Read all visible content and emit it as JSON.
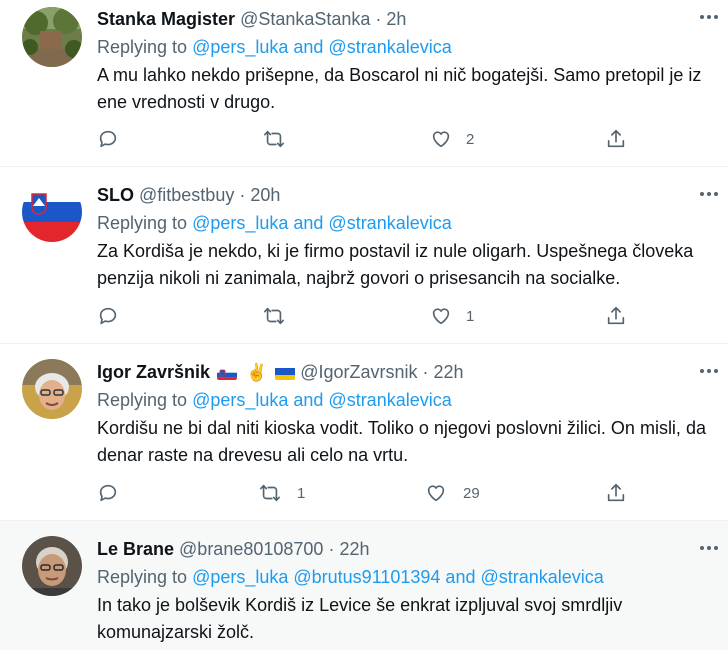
{
  "tweets": [
    {
      "name": "Stanka Magister",
      "handle": "@StankaStanka",
      "sep": "·",
      "time": "2h",
      "replying_prefix": "Replying to ",
      "mentions": "@pers_luka and @strankalevica",
      "text": "A mu lahko nekdo prišepne, da Boscarol ni nič bogatejši. Samo pretopil je iz ene vrednosti v drugo.",
      "retweets": "",
      "likes": "2"
    },
    {
      "name": "SLO",
      "handle": "@fitbestbuy",
      "sep": "·",
      "time": "20h",
      "replying_prefix": "Replying to ",
      "mentions": "@pers_luka and @strankalevica",
      "text": "Za Kordiša je nekdo, ki je firmo postavil iz nule oligarh. Uspešnega človeka penzija nikoli ni zanimala, najbrž govori o prisesancih na socialke.",
      "retweets": "",
      "likes": "1"
    },
    {
      "name": "Igor Završnik",
      "peace": "✌",
      "handle": "@IgorZavrsnik",
      "sep": "·",
      "time": "22h",
      "replying_prefix": "Replying to ",
      "mentions": "@pers_luka and @strankalevica",
      "text": "Kordišu ne bi dal niti kioska vodit. Toliko o njegovi poslovni žilici. On misli, da denar raste na drevesu ali celo na vrtu.",
      "retweets": "1",
      "likes": "29"
    },
    {
      "name": "Le Brane",
      "handle": "@brane80108700",
      "sep": "·",
      "time": "22h",
      "replying_prefix": "Replying to ",
      "mentions": "@pers_luka @brutus91101394 and @strankalevica",
      "text": "In tako je bolševik Kordiš iz Levice še enkrat izpljuval svoj smrdljiv komunajzarski žolč."
    }
  ],
  "colors": {
    "accent": "#1d9bf0",
    "secondary_text": "#536471",
    "primary_text": "#0f1419",
    "highlight_bg": "#f7f9f9"
  },
  "icons": [
    "reply-icon",
    "retweet-icon",
    "like-icon",
    "share-icon",
    "more-icon"
  ]
}
